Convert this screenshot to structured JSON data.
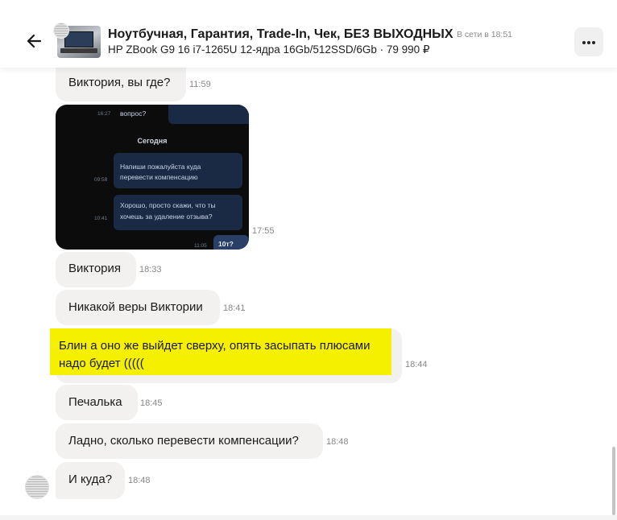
{
  "header": {
    "title": "Ноутбучная, Гарантия, Trade-In, Чек, БЕЗ ВЫХОДНЫХ",
    "status": "В сети в 18:51",
    "subtitle": "HP ZBook G9 16 i7-1265U 12-ядра 16Gb/512SSD/6Gb · 79 990 ₽",
    "back_icon": "arrow-left-icon",
    "more_icon": "three-dots-icon"
  },
  "messages": [
    {
      "text": "Виктория, вы где?",
      "time": "11:59"
    },
    {
      "type": "image",
      "time": "17:55"
    },
    {
      "text": "Виктория",
      "time": "18:33"
    },
    {
      "text": "Никакой веры Виктории",
      "time": "18:41"
    },
    {
      "lines": [
        "Блин а оно же выйдет сверху, опять засыпать плюсами",
        "надо будет ((((("
      ],
      "time": "18:44",
      "highlight_color": "#f5f000"
    },
    {
      "text": "Печалька",
      "time": "18:45"
    },
    {
      "text": "Ладно, сколько перевести компенсации?",
      "time": "18:48"
    },
    {
      "text": "И куда?",
      "time": "18:48"
    }
  ],
  "photo": {
    "top_text": "вопрос?",
    "top_time": "16:27",
    "day_label": "Сегодня",
    "msg1": [
      "Напиши пожалуйста куда",
      "перевести компенсацию"
    ],
    "msg1_time": "09:58",
    "msg2": [
      "Хорошо, просто скажи, что ты",
      "хочешь за удаление отзыва?"
    ],
    "msg2_time": "10:41",
    "reply_time": "11:05",
    "reply_text": "10т?"
  },
  "colors": {
    "bubble": "#f2f1ef",
    "highlight": "#f5f000",
    "photo_bubble": "#1b2a44"
  }
}
